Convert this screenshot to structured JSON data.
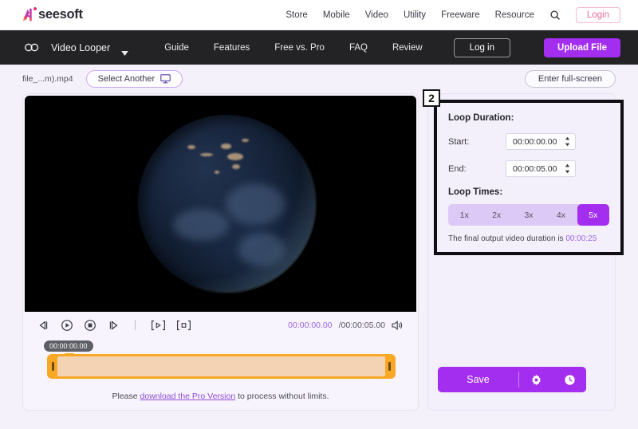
{
  "header": {
    "logo_text": "seesoft",
    "logo_alt": "Aiseesoft",
    "nav": [
      {
        "label": "Store"
      },
      {
        "label": "Mobile"
      },
      {
        "label": "Video"
      },
      {
        "label": "Utility"
      },
      {
        "label": "Freeware"
      },
      {
        "label": "Resource"
      }
    ],
    "search_icon": "search-icon",
    "login_label": "Login"
  },
  "darknav": {
    "loop_icon": "infinity-icon",
    "product": "Video Looper",
    "caret_icon": "chevron-down-icon",
    "links": [
      {
        "label": "Guide"
      },
      {
        "label": "Features"
      },
      {
        "label": "Free vs. Pro"
      },
      {
        "label": "FAQ"
      },
      {
        "label": "Review"
      }
    ],
    "login_label": "Log in",
    "upload_label": "Upload File"
  },
  "filebar": {
    "filename": "file_...m).mp4",
    "select_another_label": "Select Another",
    "monitor_icon": "monitor-icon",
    "fullscreen_label": "Enter full-screen"
  },
  "player": {
    "controls": [
      {
        "name": "rewind-icon"
      },
      {
        "name": "play-icon"
      },
      {
        "name": "stop-icon"
      },
      {
        "name": "forward-icon"
      }
    ],
    "mark_start_icon": "set-start-bracket-icon",
    "mark_end_icon": "set-end-bracket-icon",
    "current_time": "00:00:00.00",
    "separator": "/",
    "total_time": "00:00:05.00",
    "volume_icon": "volume-icon",
    "playhead_tooltip": "00:00:00.00"
  },
  "note": {
    "before": "Please ",
    "link": "download the Pro Version",
    "after": " to process without limits."
  },
  "settings": {
    "badge": "2",
    "loop_duration_title": "Loop Duration:",
    "start_label": "Start:",
    "start_value": "00:00:00.00",
    "end_label": "End:",
    "end_value": "00:00:05.00",
    "loop_times_title": "Loop Times:",
    "loop_options": [
      {
        "label": "1x",
        "selected": false
      },
      {
        "label": "2x",
        "selected": false
      },
      {
        "label": "3x",
        "selected": false
      },
      {
        "label": "4x",
        "selected": false
      },
      {
        "label": "5x",
        "selected": true
      }
    ],
    "final_note_text": "The final output video duration is ",
    "final_duration": "00:00:25"
  },
  "actions": {
    "save_label": "Save",
    "gear_icon": "gear-icon",
    "clock_icon": "clock-icon"
  },
  "colors": {
    "accent_purple": "#a32ef0",
    "light_purple": "#9b63e6",
    "pink": "#f06a9e",
    "timeline_orange": "#f9a825",
    "dark_nav": "#232326",
    "page_bg": "#f4f1fb"
  }
}
